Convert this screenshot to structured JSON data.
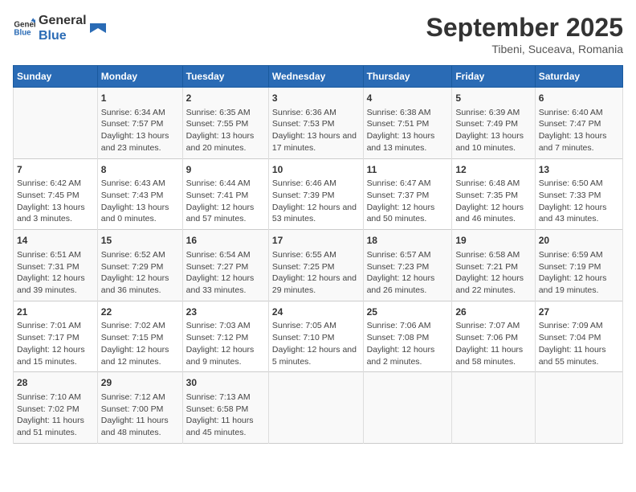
{
  "header": {
    "logo_line1": "General",
    "logo_line2": "Blue",
    "month": "September 2025",
    "location": "Tibeni, Suceava, Romania"
  },
  "days_of_week": [
    "Sunday",
    "Monday",
    "Tuesday",
    "Wednesday",
    "Thursday",
    "Friday",
    "Saturday"
  ],
  "weeks": [
    [
      {
        "num": "",
        "content": ""
      },
      {
        "num": "1",
        "content": "Sunrise: 6:34 AM\nSunset: 7:57 PM\nDaylight: 13 hours and 23 minutes."
      },
      {
        "num": "2",
        "content": "Sunrise: 6:35 AM\nSunset: 7:55 PM\nDaylight: 13 hours and 20 minutes."
      },
      {
        "num": "3",
        "content": "Sunrise: 6:36 AM\nSunset: 7:53 PM\nDaylight: 13 hours and 17 minutes."
      },
      {
        "num": "4",
        "content": "Sunrise: 6:38 AM\nSunset: 7:51 PM\nDaylight: 13 hours and 13 minutes."
      },
      {
        "num": "5",
        "content": "Sunrise: 6:39 AM\nSunset: 7:49 PM\nDaylight: 13 hours and 10 minutes."
      },
      {
        "num": "6",
        "content": "Sunrise: 6:40 AM\nSunset: 7:47 PM\nDaylight: 13 hours and 7 minutes."
      }
    ],
    [
      {
        "num": "7",
        "content": "Sunrise: 6:42 AM\nSunset: 7:45 PM\nDaylight: 13 hours and 3 minutes."
      },
      {
        "num": "8",
        "content": "Sunrise: 6:43 AM\nSunset: 7:43 PM\nDaylight: 13 hours and 0 minutes."
      },
      {
        "num": "9",
        "content": "Sunrise: 6:44 AM\nSunset: 7:41 PM\nDaylight: 12 hours and 57 minutes."
      },
      {
        "num": "10",
        "content": "Sunrise: 6:46 AM\nSunset: 7:39 PM\nDaylight: 12 hours and 53 minutes."
      },
      {
        "num": "11",
        "content": "Sunrise: 6:47 AM\nSunset: 7:37 PM\nDaylight: 12 hours and 50 minutes."
      },
      {
        "num": "12",
        "content": "Sunrise: 6:48 AM\nSunset: 7:35 PM\nDaylight: 12 hours and 46 minutes."
      },
      {
        "num": "13",
        "content": "Sunrise: 6:50 AM\nSunset: 7:33 PM\nDaylight: 12 hours and 43 minutes."
      }
    ],
    [
      {
        "num": "14",
        "content": "Sunrise: 6:51 AM\nSunset: 7:31 PM\nDaylight: 12 hours and 39 minutes."
      },
      {
        "num": "15",
        "content": "Sunrise: 6:52 AM\nSunset: 7:29 PM\nDaylight: 12 hours and 36 minutes."
      },
      {
        "num": "16",
        "content": "Sunrise: 6:54 AM\nSunset: 7:27 PM\nDaylight: 12 hours and 33 minutes."
      },
      {
        "num": "17",
        "content": "Sunrise: 6:55 AM\nSunset: 7:25 PM\nDaylight: 12 hours and 29 minutes."
      },
      {
        "num": "18",
        "content": "Sunrise: 6:57 AM\nSunset: 7:23 PM\nDaylight: 12 hours and 26 minutes."
      },
      {
        "num": "19",
        "content": "Sunrise: 6:58 AM\nSunset: 7:21 PM\nDaylight: 12 hours and 22 minutes."
      },
      {
        "num": "20",
        "content": "Sunrise: 6:59 AM\nSunset: 7:19 PM\nDaylight: 12 hours and 19 minutes."
      }
    ],
    [
      {
        "num": "21",
        "content": "Sunrise: 7:01 AM\nSunset: 7:17 PM\nDaylight: 12 hours and 15 minutes."
      },
      {
        "num": "22",
        "content": "Sunrise: 7:02 AM\nSunset: 7:15 PM\nDaylight: 12 hours and 12 minutes."
      },
      {
        "num": "23",
        "content": "Sunrise: 7:03 AM\nSunset: 7:12 PM\nDaylight: 12 hours and 9 minutes."
      },
      {
        "num": "24",
        "content": "Sunrise: 7:05 AM\nSunset: 7:10 PM\nDaylight: 12 hours and 5 minutes."
      },
      {
        "num": "25",
        "content": "Sunrise: 7:06 AM\nSunset: 7:08 PM\nDaylight: 12 hours and 2 minutes."
      },
      {
        "num": "26",
        "content": "Sunrise: 7:07 AM\nSunset: 7:06 PM\nDaylight: 11 hours and 58 minutes."
      },
      {
        "num": "27",
        "content": "Sunrise: 7:09 AM\nSunset: 7:04 PM\nDaylight: 11 hours and 55 minutes."
      }
    ],
    [
      {
        "num": "28",
        "content": "Sunrise: 7:10 AM\nSunset: 7:02 PM\nDaylight: 11 hours and 51 minutes."
      },
      {
        "num": "29",
        "content": "Sunrise: 7:12 AM\nSunset: 7:00 PM\nDaylight: 11 hours and 48 minutes."
      },
      {
        "num": "30",
        "content": "Sunrise: 7:13 AM\nSunset: 6:58 PM\nDaylight: 11 hours and 45 minutes."
      },
      {
        "num": "",
        "content": ""
      },
      {
        "num": "",
        "content": ""
      },
      {
        "num": "",
        "content": ""
      },
      {
        "num": "",
        "content": ""
      }
    ]
  ]
}
